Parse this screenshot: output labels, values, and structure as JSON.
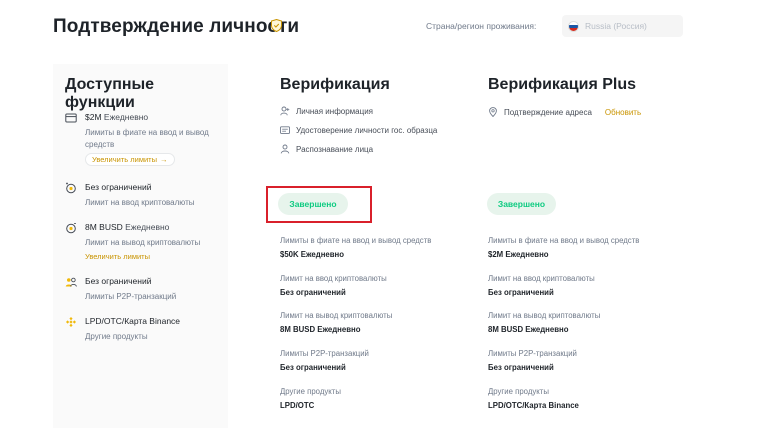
{
  "header": {
    "title": "Подтверждение личности",
    "region_label": "Страна/регион проживания:",
    "region_value": "Russia (Россия)"
  },
  "left_panel": {
    "title": "Доступные функции",
    "features": [
      {
        "icon": "card-icon",
        "main": "$2M",
        "main_sub": "Ежедневно",
        "desc": "Лимиты в фиате на ввод и вывод средств",
        "action": "Увеличить лимиты",
        "action_style": "button"
      },
      {
        "icon": "crypto-deposit-icon",
        "main": "Без ограничений",
        "main_sub": "",
        "desc": "Лимит на ввод криптовалюты",
        "action": "",
        "action_style": ""
      },
      {
        "icon": "crypto-withdraw-icon",
        "main": "8M BUSD",
        "main_sub": "Ежедневно",
        "desc": "Лимит на вывод криптовалюты",
        "action": "Увеличить лимиты",
        "action_style": "plain"
      },
      {
        "icon": "p2p-users-icon",
        "main": "Без ограничений",
        "main_sub": "",
        "desc": "Лимиты P2P-транзакций",
        "action": "",
        "action_style": ""
      },
      {
        "icon": "binance-logo-icon",
        "main": "LPD/OTC/Карта Binance",
        "main_sub": "",
        "desc": "Другие продукты",
        "action": "",
        "action_style": ""
      }
    ]
  },
  "verification": {
    "title": "Верификация",
    "requirements": [
      {
        "icon": "user-icon",
        "label": "Личная информация"
      },
      {
        "icon": "id-card-icon",
        "label": "Удостоверение личности гос. образца"
      },
      {
        "icon": "face-icon",
        "label": "Распознавание лица"
      }
    ],
    "status": "Завершено",
    "limits": [
      {
        "label": "Лимиты в фиате на ввод и вывод средств",
        "value": "$50K Ежедневно"
      },
      {
        "label": "Лимит на ввод криптовалюты",
        "value": "Без ограничений"
      },
      {
        "label": "Лимит на вывод криптовалюты",
        "value": "8M BUSD Ежедневно"
      },
      {
        "label": "Лимиты P2P-транзакций",
        "value": "Без ограничений"
      },
      {
        "label": "Другие продукты",
        "value": "LPD/OTC"
      }
    ]
  },
  "verification_plus": {
    "title": "Верификация Plus",
    "requirements": [
      {
        "icon": "location-pin-icon",
        "label": "Подтверждение адреса",
        "action": "Обновить"
      }
    ],
    "status": "Завершено",
    "limits": [
      {
        "label": "Лимиты в фиате на ввод и вывод средств",
        "value": "$2M Ежедневно"
      },
      {
        "label": "Лимит на ввод криптовалюты",
        "value": "Без ограничений"
      },
      {
        "label": "Лимит на вывод криптовалюты",
        "value": "8M BUSD Ежедневно"
      },
      {
        "label": "Лимиты P2P-транзакций",
        "value": "Без ограничений"
      },
      {
        "label": "Другие продукты",
        "value": "LPD/OTC/Карта Binance"
      }
    ]
  },
  "colors": {
    "accent": "#c99400",
    "success": "#0ecb81",
    "success_bg": "#e7f4ec",
    "highlight": "#d9202b"
  }
}
